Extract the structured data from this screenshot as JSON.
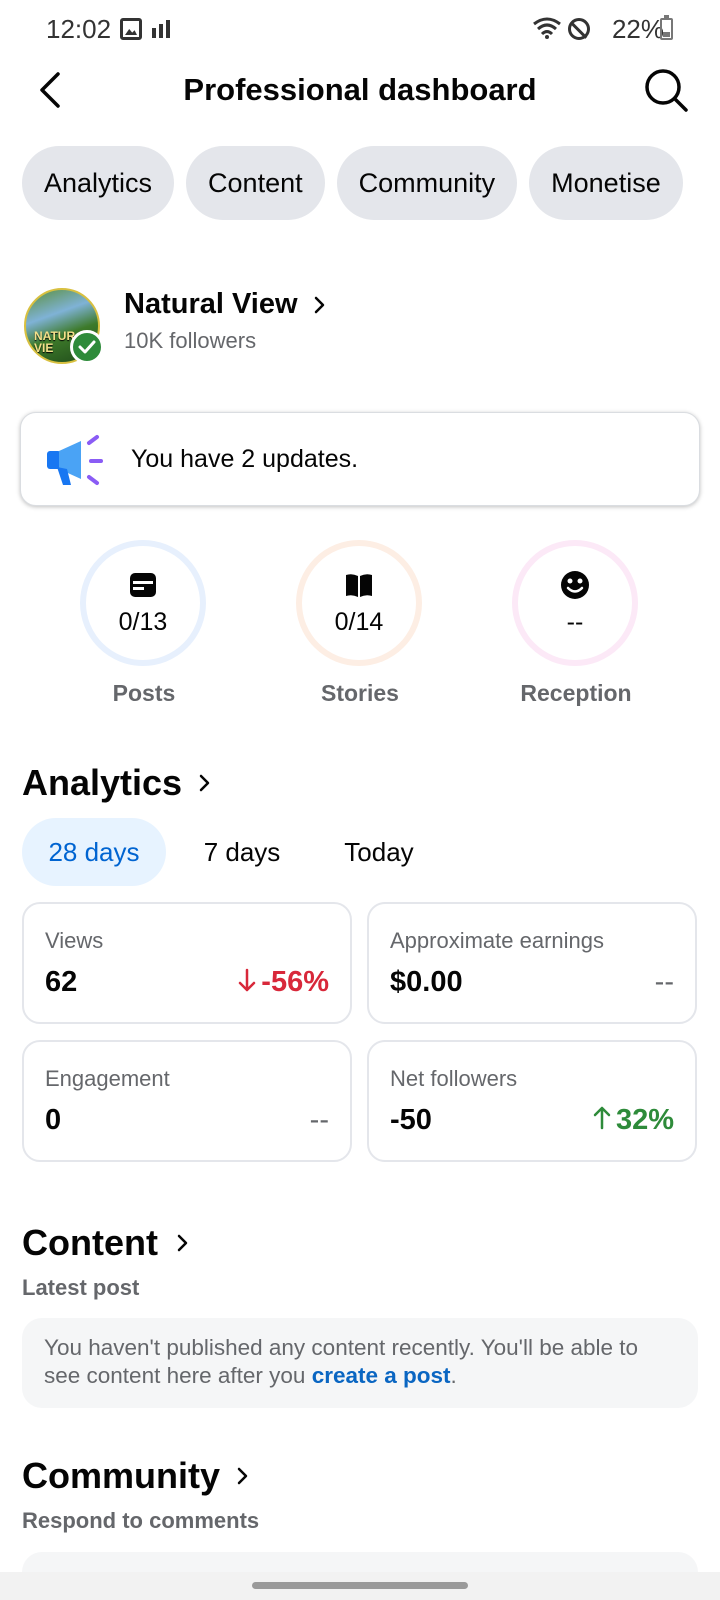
{
  "status_bar": {
    "time": "12:02",
    "battery": "22%"
  },
  "header": {
    "title": "Professional dashboard",
    "back_icon": "back-arrow-icon",
    "search_icon": "search-icon"
  },
  "chips": [
    {
      "label": "Analytics"
    },
    {
      "label": "Content"
    },
    {
      "label": "Community"
    },
    {
      "label": "Monetise"
    }
  ],
  "profile": {
    "name": "Natural View",
    "followers": "10K followers",
    "avatar_text_line1": "NATUR",
    "avatar_text_line2": "VIE"
  },
  "updates": {
    "text": "You have 2 updates.",
    "icon": "megaphone-icon"
  },
  "rings": [
    {
      "label": "Posts",
      "value": "0/13",
      "icon": "post-icon",
      "color": "#e7f0fd"
    },
    {
      "label": "Stories",
      "value": "0/14",
      "icon": "book-icon",
      "color": "#fdeee4"
    },
    {
      "label": "Reception",
      "value": "--",
      "icon": "smiley-icon",
      "color": "#fce9f7"
    }
  ],
  "analytics": {
    "title": "Analytics",
    "tabs": [
      {
        "label": "28 days",
        "active": true
      },
      {
        "label": "7 days",
        "active": false
      },
      {
        "label": "Today",
        "active": false
      }
    ],
    "metrics": [
      {
        "label": "Views",
        "value": "62",
        "change": "-56%",
        "trend": "down"
      },
      {
        "label": "Approximate earnings",
        "value": "$0.00",
        "change": "--",
        "trend": "neutral"
      },
      {
        "label": "Engagement",
        "value": "0",
        "change": "--",
        "trend": "neutral"
      },
      {
        "label": "Net followers",
        "value": "-50",
        "change": "32%",
        "trend": "up"
      }
    ]
  },
  "content": {
    "title": "Content",
    "subtitle": "Latest post",
    "message": "You haven't published any content recently. You'll be able to see content here after you",
    "link": "create a post",
    "suffix": "."
  },
  "community": {
    "title": "Community",
    "subtitle": "Respond to comments"
  },
  "colors": {
    "accent_blue": "#0064d1",
    "up_green": "#2e8b3a",
    "down_red": "#d8283a",
    "chip_bg": "#e4e6eb"
  }
}
